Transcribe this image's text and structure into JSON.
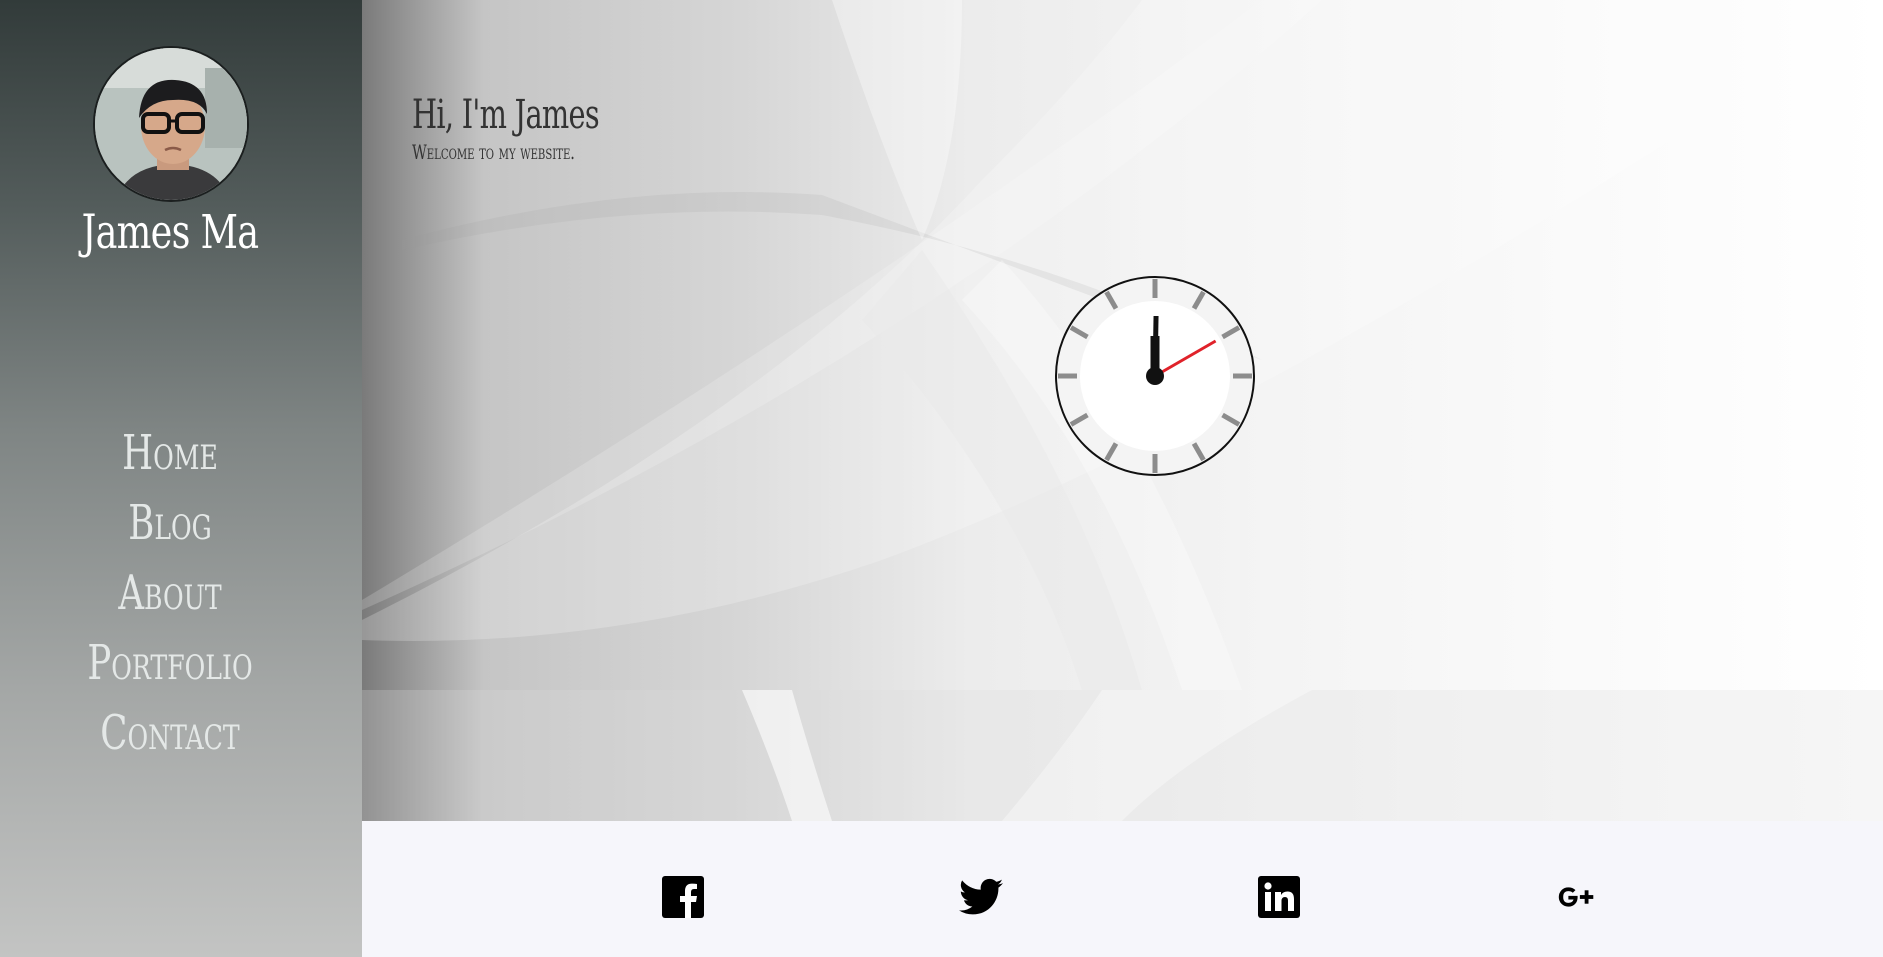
{
  "sidebar": {
    "name": "James Ma",
    "avatar_icon": "profile-photo",
    "nav": [
      {
        "label": "Home"
      },
      {
        "label": "Blog"
      },
      {
        "label": "About"
      },
      {
        "label": "Portfolio"
      },
      {
        "label": "Contact"
      }
    ]
  },
  "hero": {
    "title": "Hi, I'm James",
    "subtitle": "Welcome to my website."
  },
  "clock": {
    "hour": 12,
    "minute": 0,
    "second": 10,
    "second_hand_color": "#e0222a"
  },
  "social": [
    {
      "icon": "facebook-icon"
    },
    {
      "icon": "twitter-icon"
    },
    {
      "icon": "linkedin-icon"
    },
    {
      "icon": "google-plus-icon"
    }
  ],
  "colors": {
    "sidebar_top": "#323b3a",
    "sidebar_bottom": "#c3c4c3",
    "footer_bg": "#f6f6fb",
    "text_dark": "#333333"
  }
}
